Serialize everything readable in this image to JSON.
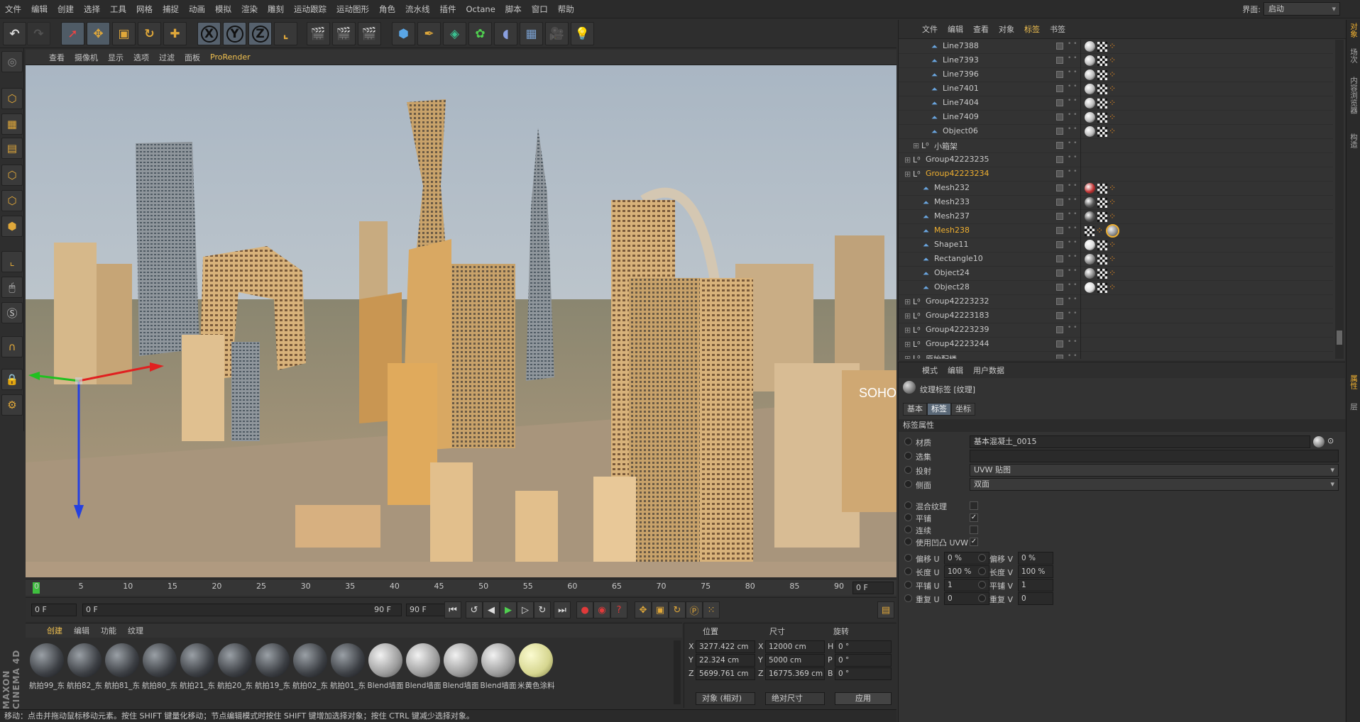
{
  "menu": [
    "文件",
    "编辑",
    "创建",
    "选择",
    "工具",
    "网格",
    "捕捉",
    "动画",
    "模拟",
    "渲染",
    "雕刻",
    "运动跟踪",
    "运动图形",
    "角色",
    "流水线",
    "插件",
    "Octane",
    "脚本",
    "窗口",
    "帮助"
  ],
  "layout": {
    "label": "界面:",
    "value": "启动"
  },
  "toolbar": {
    "x_label": "X",
    "y_label": "Y",
    "z_label": "Z"
  },
  "viewport_menu": [
    "查看",
    "摄像机",
    "显示",
    "选项",
    "过滤",
    "面板"
  ],
  "viewport_prorender": "ProRender",
  "viewport_label": "SOHO",
  "timeline": {
    "ticks": [
      "0",
      "5",
      "10",
      "15",
      "20",
      "25",
      "30",
      "35",
      "40",
      "45",
      "50",
      "55",
      "60",
      "65",
      "70",
      "75",
      "80",
      "85",
      "90"
    ],
    "current_frame": "0 F"
  },
  "transport": {
    "start": "0 F",
    "range_start": "0 F",
    "range_end": "90 F",
    "end": "90 F"
  },
  "materials": {
    "menu": [
      "创建",
      "编辑",
      "功能",
      "纹理"
    ],
    "items": [
      {
        "label": "航拍99_东",
        "kind": "textured"
      },
      {
        "label": "航拍82_东",
        "kind": "textured"
      },
      {
        "label": "航拍81_东",
        "kind": "textured"
      },
      {
        "label": "航拍80_东",
        "kind": "textured"
      },
      {
        "label": "航拍21_东",
        "kind": "textured"
      },
      {
        "label": "航拍20_东",
        "kind": "textured"
      },
      {
        "label": "航拍19_东",
        "kind": "textured"
      },
      {
        "label": "航拍02_东",
        "kind": "textured"
      },
      {
        "label": "航拍01_东",
        "kind": "textured"
      },
      {
        "label": "Blend墙面",
        "kind": "grey"
      },
      {
        "label": "Blend墙面",
        "kind": "grey"
      },
      {
        "label": "Blend墙面",
        "kind": "grey"
      },
      {
        "label": "Blend墙面",
        "kind": "grey"
      },
      {
        "label": "米黄色涂料",
        "kind": "cream"
      }
    ]
  },
  "coordinates": {
    "headers": {
      "position": "位置",
      "size": "尺寸",
      "rotation": "旋转"
    },
    "rows": [
      {
        "axis": "X",
        "pos": "3277.422 cm",
        "size_axis": "X",
        "size": "12000 cm",
        "rot_axis": "H",
        "rot": "0 °"
      },
      {
        "axis": "Y",
        "pos": "22.324 cm",
        "size_axis": "Y",
        "size": "5000 cm",
        "rot_axis": "P",
        "rot": "0 °"
      },
      {
        "axis": "Z",
        "pos": "5699.761 cm",
        "size_axis": "Z",
        "size": "16775.369 cm",
        "rot_axis": "B",
        "rot": "0 °"
      }
    ],
    "mode": "对象 (相对)",
    "size_mode": "绝对尺寸",
    "apply": "应用"
  },
  "status": "移动：点击并拖动鼠标移动元素。按住 SHIFT 键量化移动；节点编辑模式时按住 SHIFT 键增加选择对象；按住 CTRL 键减少选择对象。",
  "object_manager": {
    "menu": [
      "文件",
      "编辑",
      "查看",
      "对象",
      "标签",
      "书签"
    ],
    "rows": [
      {
        "name": "Line7388",
        "indent": 2,
        "type": "spline",
        "tags": "spline"
      },
      {
        "name": "Line7393",
        "indent": 2,
        "type": "spline",
        "tags": "spline"
      },
      {
        "name": "Line7396",
        "indent": 2,
        "type": "spline",
        "tags": "spline"
      },
      {
        "name": "Line7401",
        "indent": 2,
        "type": "spline",
        "tags": "spline"
      },
      {
        "name": "Line7404",
        "indent": 2,
        "type": "spline",
        "tags": "spline"
      },
      {
        "name": "Line7409",
        "indent": 2,
        "type": "spline",
        "tags": "spline"
      },
      {
        "name": "Object06",
        "indent": 2,
        "type": "spline",
        "tags": "spline"
      },
      {
        "name": "小箱架",
        "indent": 1,
        "type": "null",
        "tags": "none"
      },
      {
        "name": "Group42223235",
        "indent": 0,
        "type": "null",
        "tags": "none"
      },
      {
        "name": "Group42223234",
        "indent": 0,
        "type": "null",
        "tags": "none",
        "selected": true
      },
      {
        "name": "Mesh232",
        "indent": 1,
        "type": "mesh",
        "tags": "red"
      },
      {
        "name": "Mesh233",
        "indent": 1,
        "type": "mesh",
        "tags": "dark"
      },
      {
        "name": "Mesh237",
        "indent": 1,
        "type": "mesh",
        "tags": "dark"
      },
      {
        "name": "Mesh238",
        "indent": 1,
        "type": "mesh",
        "tags": "active",
        "selected": true
      },
      {
        "name": "Shape11",
        "indent": 1,
        "type": "mesh",
        "tags": "white"
      },
      {
        "name": "Rectangle10",
        "indent": 1,
        "type": "mesh",
        "tags": "grey"
      },
      {
        "name": "Object24",
        "indent": 1,
        "type": "mesh",
        "tags": "grey"
      },
      {
        "name": "Object28",
        "indent": 1,
        "type": "mesh",
        "tags": "white"
      },
      {
        "name": "Group42223232",
        "indent": 0,
        "type": "null",
        "tags": "none"
      },
      {
        "name": "Group42223183",
        "indent": 0,
        "type": "null",
        "tags": "none"
      },
      {
        "name": "Group42223239",
        "indent": 0,
        "type": "null",
        "tags": "none"
      },
      {
        "name": "Group42223244",
        "indent": 0,
        "type": "null",
        "tags": "none"
      },
      {
        "name": "原始配楼",
        "indent": 0,
        "type": "null",
        "tags": "none"
      }
    ]
  },
  "attribute_manager": {
    "menu": [
      "模式",
      "编辑",
      "用户数据"
    ],
    "title": "纹理标签 [纹理]",
    "tabs": [
      "基本",
      "标签",
      "坐标"
    ],
    "section": "标签属性",
    "fields": [
      {
        "label": "材质",
        "value": "基本混凝土_0015",
        "kind": "link"
      },
      {
        "label": "选集",
        "value": "",
        "kind": "text"
      },
      {
        "label": "投射",
        "value": "UVW 贴图",
        "kind": "dropdown"
      },
      {
        "label": "侧面",
        "value": "双面",
        "kind": "dropdown"
      }
    ],
    "checks": [
      {
        "label": "混合纹理",
        "checked": false
      },
      {
        "label": "平铺",
        "checked": true
      },
      {
        "label": "连续",
        "checked": false
      },
      {
        "label": "使用凹凸 UVW",
        "checked": true
      }
    ],
    "numbers": [
      {
        "label_u": "偏移 U",
        "value_u": "0 %",
        "label_v": "偏移 V",
        "value_v": "0 %"
      },
      {
        "label_u": "长度 U",
        "value_u": "100 %",
        "label_v": "长度 V",
        "value_v": "100 %"
      },
      {
        "label_u": "平铺 U",
        "value_u": "1",
        "label_v": "平铺 V",
        "value_v": "1"
      },
      {
        "label_u": "重复 U",
        "value_u": "0",
        "label_v": "重复 V",
        "value_v": "0"
      }
    ]
  },
  "right_tabs": [
    "对象",
    "场次",
    "内容浏览器",
    "构造",
    "属性",
    "层"
  ],
  "brand": "MAXON CINEMA 4D",
  "colors": {
    "accent": "#f0b030",
    "active_tab": "#5a6877",
    "viewport_sky": "#b9c3cc"
  }
}
